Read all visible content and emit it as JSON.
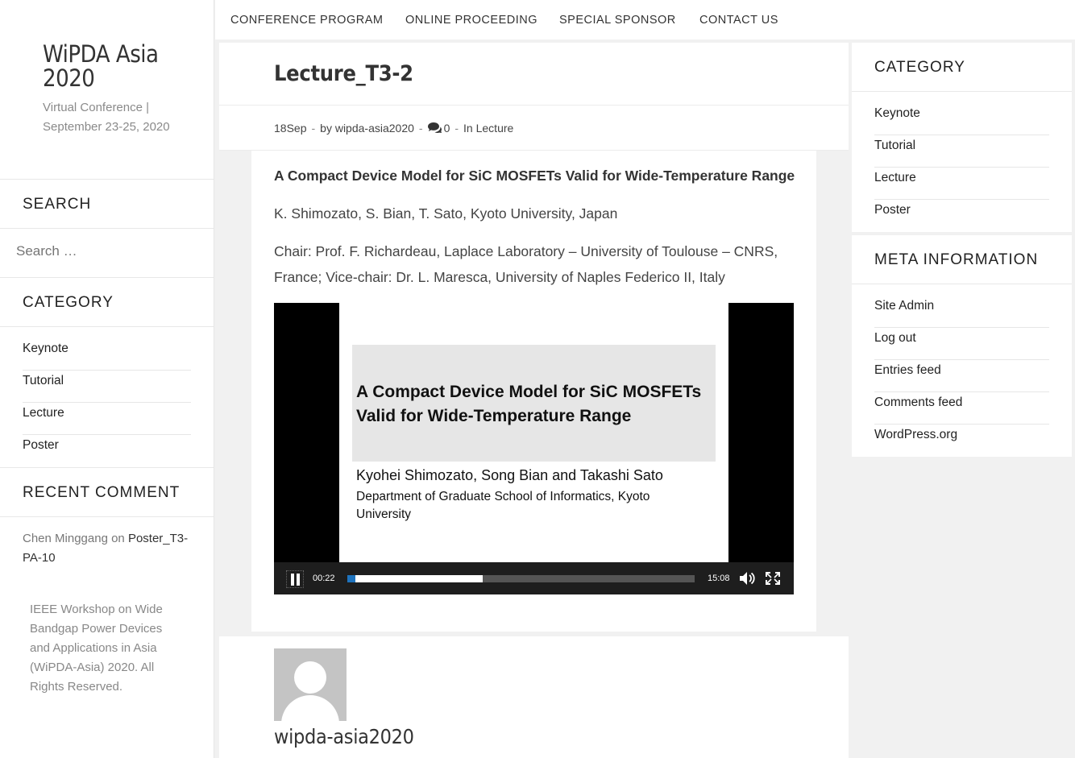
{
  "site": {
    "title": "WiPDA Asia 2020",
    "description": "Virtual Conference | September 23-25, 2020"
  },
  "nav": {
    "items": [
      "CONFERENCE PROGRAM",
      "ONLINE PROCEEDING",
      "SPECIAL SPONSOR",
      "CONTACT US"
    ]
  },
  "left_sidebar": {
    "search_heading": "SEARCH",
    "search_placeholder": "Search …",
    "category_heading": "CATEGORY",
    "categories": [
      "Keynote",
      "Tutorial",
      "Lecture",
      "Poster"
    ],
    "recent_heading": "RECENT COMMENT",
    "recent_comment": {
      "author": "Chen Minggang",
      "on": "on",
      "post": "Poster_T3-PA-10"
    },
    "footer": "IEEE Workshop on Wide Bandgap Power Devices and Applications in Asia (WiPDA-Asia) 2020. All Rights Reserved."
  },
  "post": {
    "title": "Lecture_T3-2",
    "meta": {
      "date": "18Sep",
      "by": "by wipda-asia2020",
      "comments": "0",
      "category": "In Lecture",
      "separator": "-"
    },
    "heading": "A Compact Device Model for SiC MOSFETs Valid for Wide-Temperature Range",
    "authors": "K. Shimozato, S. Bian, T. Sato, Kyoto University, Japan",
    "chair": "Chair: Prof. F. Richardeau, Laplace Laboratory – University of Toulouse – CNRS, France; Vice-chair: Dr. L. Maresca, University of Naples Federico II, Italy"
  },
  "video": {
    "slide_title": "A Compact Device Model for SiC MOSFETs Valid for Wide-Temperature Range",
    "slide_authors": "Kyohei Shimozato, Song Bian and Takashi Sato",
    "slide_dept": "Department of Graduate School of Informatics, Kyoto University",
    "current_time": "00:22",
    "duration": "15:08",
    "played_fraction": 0.024,
    "buffered_fraction": 0.39,
    "state": "playing"
  },
  "author_box": {
    "name": "wipda-asia2020"
  },
  "right_sidebar": {
    "category_heading": "CATEGORY",
    "categories": [
      "Keynote",
      "Tutorial",
      "Lecture",
      "Poster"
    ],
    "meta_heading": "META INFORMATION",
    "meta_links": [
      "Site Admin",
      "Log out",
      "Entries feed",
      "Comments feed",
      "WordPress.org"
    ]
  },
  "colors": {
    "page_bg": "#f1f1f1",
    "progress_accent": "#1e73be"
  }
}
